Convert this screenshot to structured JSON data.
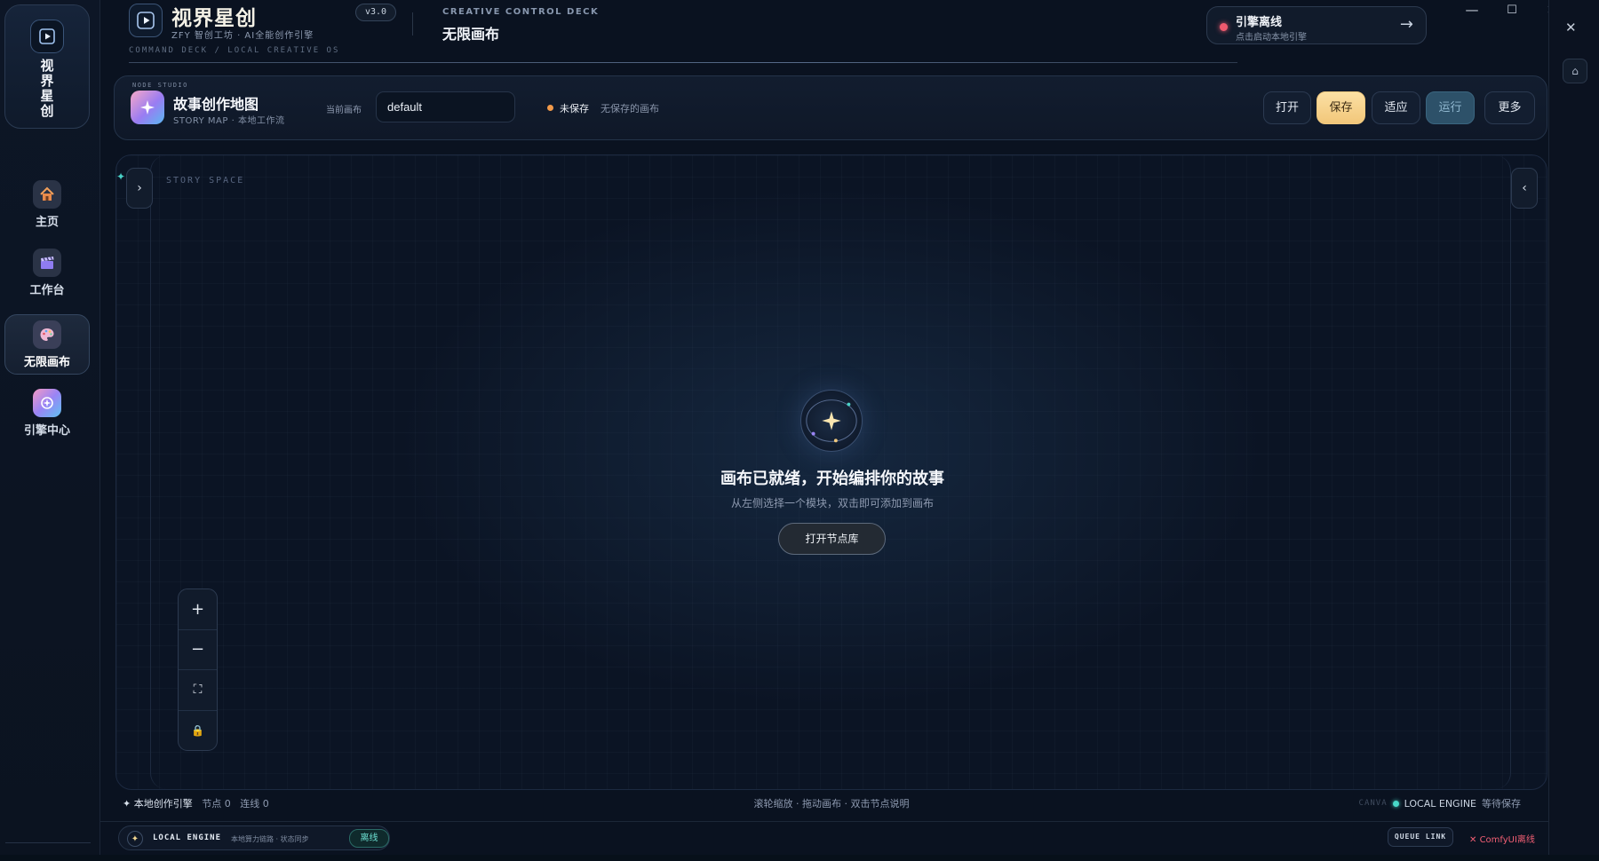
{
  "sidebar": {
    "logo_text": "视界星创",
    "items": [
      {
        "label": "主页",
        "icon": "house-icon",
        "active": false
      },
      {
        "label": "工作台",
        "icon": "clapperboard-icon",
        "active": false
      },
      {
        "label": "无限画布",
        "icon": "palette-icon",
        "active": true
      },
      {
        "label": "引擎中心",
        "icon": "engine-icon",
        "active": false
      }
    ]
  },
  "header": {
    "brand_title": "视界星创",
    "brand_sub": "ZFY 智创工坊 · AI全能创作引擎",
    "version": "v3.0",
    "path": "COMMAND DECK / LOCAL CREATIVE OS",
    "deck_label": "CREATIVE CONTROL DECK",
    "deck_title": "无限画布",
    "engine_title": "引擎离线",
    "engine_sub": "点击启动本地引擎",
    "engine_arrow": "→",
    "engine_status_color": "#f05a6e"
  },
  "studio": {
    "tag": "NODE STUDIO",
    "title": "故事创作地图",
    "subtitle": "STORY MAP · 本地工作流",
    "canvas_label": "当前画布",
    "canvas_value": "default",
    "unsaved_label": "未保存",
    "unsaved_note": "无保存的画布",
    "buttons": {
      "open": "打开",
      "save": "保存",
      "fit": "适应",
      "run": "运行",
      "more": "更多"
    }
  },
  "canvas": {
    "story_space": "STORY SPACE",
    "empty_title": "画布已就绪，开始编排你的故事",
    "empty_sub": "从左侧选择一个模块，双击即可添加到画布",
    "open_library": "打开节点库",
    "left_toggle": "›",
    "right_toggle": "‹",
    "zoom": {
      "zoom_in": "+",
      "zoom_out": "−",
      "fit": "⛶",
      "lock": "🔒"
    }
  },
  "status": {
    "left_prefix": "✦ 本地创作引擎",
    "nodes": "节点 0",
    "links": "连线 0",
    "hint": "滚轮缩放 · 拖动画布 · 双击节点说明",
    "ghost": "CANVA",
    "engine": "LOCAL ENGINE",
    "save_state": "等待保存"
  },
  "footer": {
    "engine_label": "LOCAL ENGINE",
    "engine_sub": "本地算力链路 · 状态同步",
    "engine_status": "离线",
    "queue_link": "QUEUE LINK",
    "comfy_status": "ComfyUI离线"
  },
  "window": {
    "minimize": "—",
    "maximize": "☐",
    "close": "✕",
    "rail_close": "✕",
    "rail_home": "⌂"
  }
}
